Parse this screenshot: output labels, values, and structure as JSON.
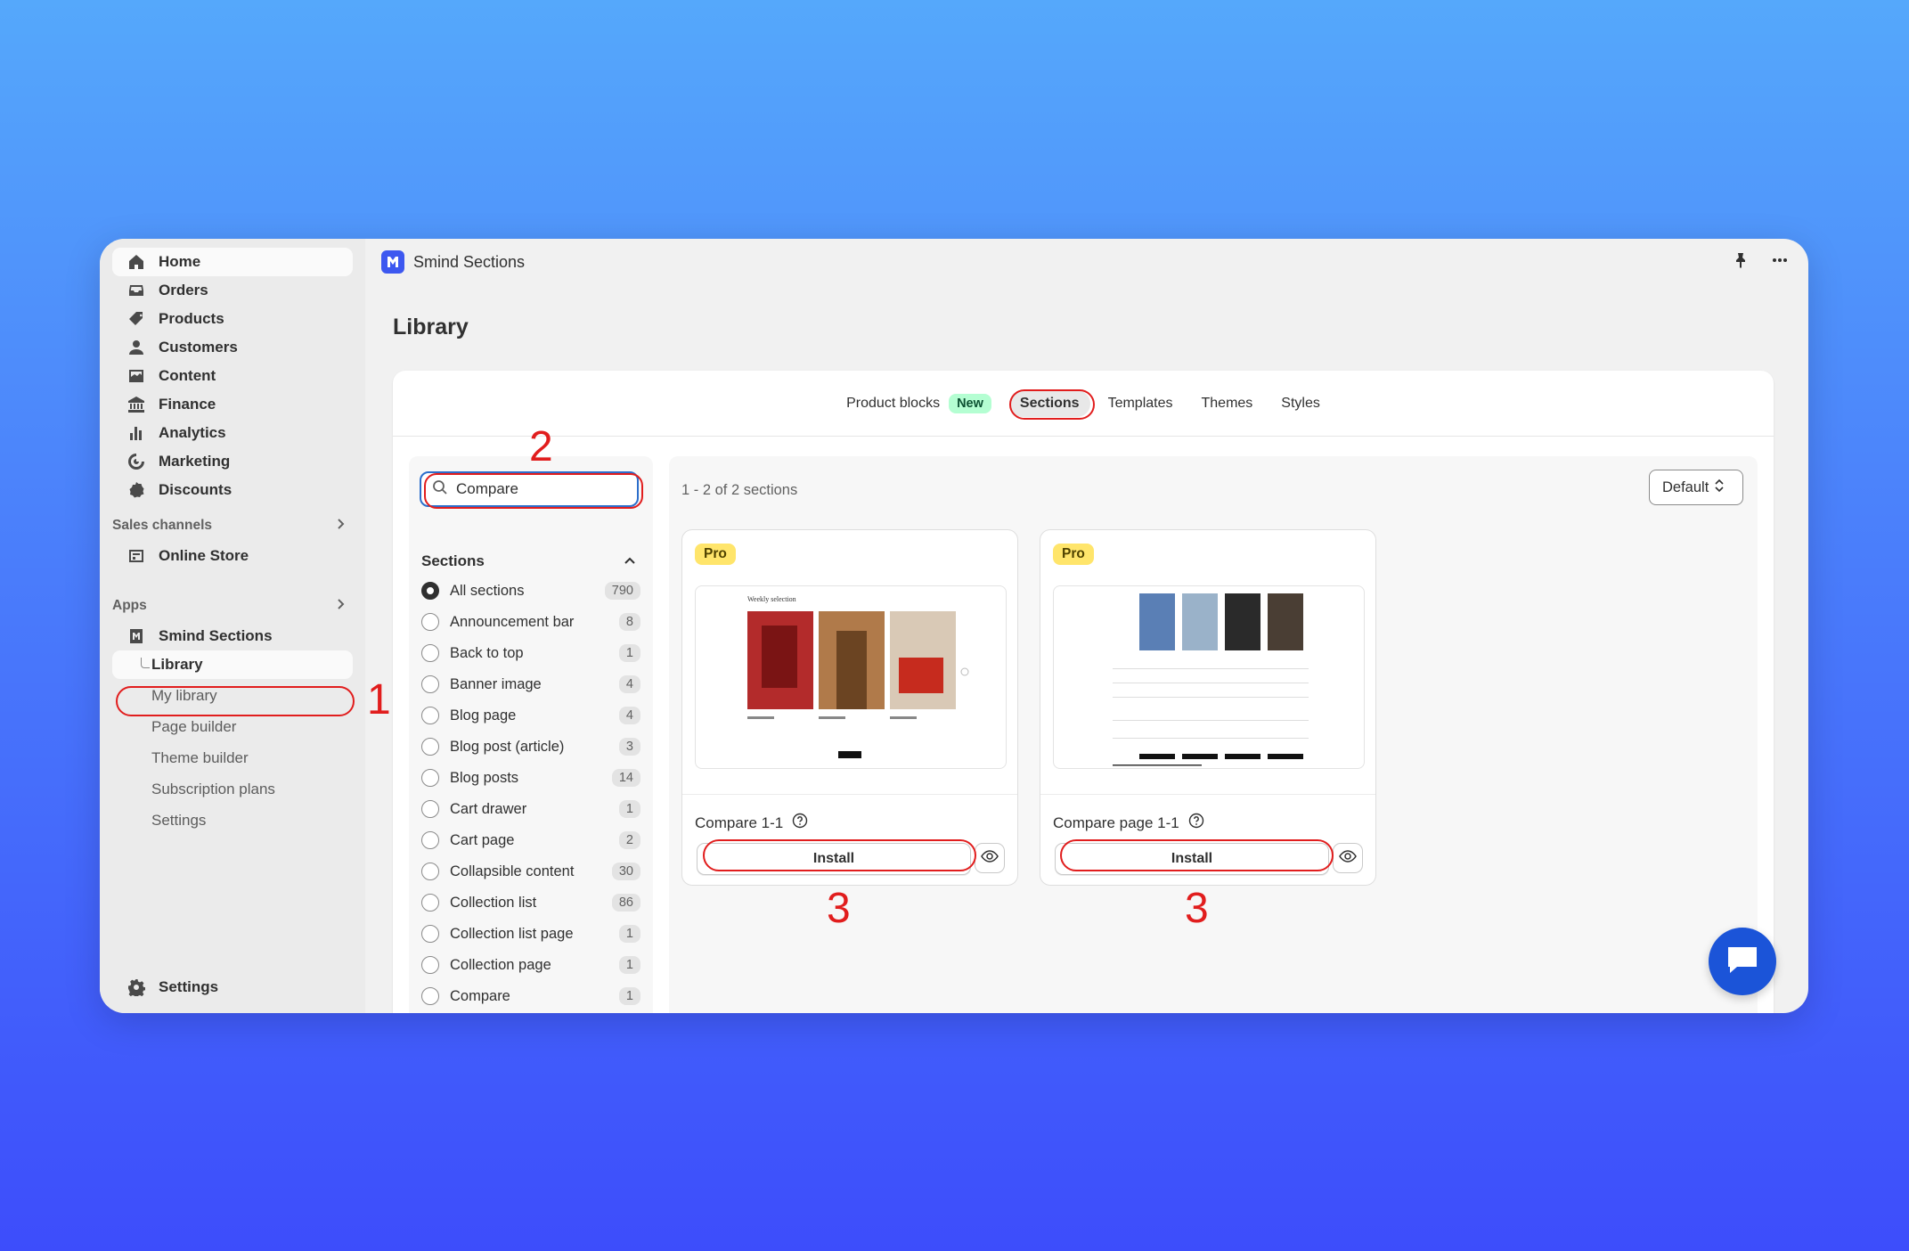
{
  "window": {
    "app_title": "Smind Sections",
    "page_title": "Library"
  },
  "sidebar": {
    "main_items": [
      {
        "label": "Home",
        "icon": "home-icon"
      },
      {
        "label": "Orders",
        "icon": "inbox-icon"
      },
      {
        "label": "Products",
        "icon": "tag-icon"
      },
      {
        "label": "Customers",
        "icon": "person-icon"
      },
      {
        "label": "Content",
        "icon": "content-icon"
      },
      {
        "label": "Finance",
        "icon": "bank-icon"
      },
      {
        "label": "Analytics",
        "icon": "bar-chart-icon"
      },
      {
        "label": "Marketing",
        "icon": "target-icon"
      },
      {
        "label": "Discounts",
        "icon": "discount-icon"
      }
    ],
    "sales_channels_heading": "Sales channels",
    "online_store": "Online Store",
    "apps_heading": "Apps",
    "app_name": "Smind Sections",
    "app_subitems": [
      "Library",
      "My library",
      "Page builder",
      "Theme builder",
      "Subscription plans",
      "Settings"
    ],
    "settings": "Settings"
  },
  "tabs": {
    "product_blocks": "Product blocks",
    "new_badge": "New",
    "sections": "Sections",
    "templates": "Templates",
    "themes": "Themes",
    "styles": "Styles"
  },
  "filters": {
    "search_value": "Compare",
    "sections_title": "Sections",
    "options": [
      {
        "label": "All sections",
        "count": "790",
        "selected": true
      },
      {
        "label": "Announcement bar",
        "count": "8"
      },
      {
        "label": "Back to top",
        "count": "1"
      },
      {
        "label": "Banner image",
        "count": "4"
      },
      {
        "label": "Blog page",
        "count": "4"
      },
      {
        "label": "Blog post (article)",
        "count": "3"
      },
      {
        "label": "Blog posts",
        "count": "14"
      },
      {
        "label": "Cart drawer",
        "count": "1"
      },
      {
        "label": "Cart page",
        "count": "2"
      },
      {
        "label": "Collapsible content",
        "count": "30"
      },
      {
        "label": "Collection list",
        "count": "86"
      },
      {
        "label": "Collection list page",
        "count": "1"
      },
      {
        "label": "Collection page",
        "count": "1"
      },
      {
        "label": "Compare",
        "count": "1"
      }
    ]
  },
  "results": {
    "count_text": "1 - 2 of 2 sections",
    "sort_label": "Default",
    "cards": [
      {
        "badge": "Pro",
        "name": "Compare 1-1",
        "install": "Install",
        "preview_title": "Weekly selection"
      },
      {
        "badge": "Pro",
        "name": "Compare page 1-1",
        "install": "Install"
      }
    ]
  },
  "annotations": [
    "1",
    "2",
    "3",
    "3"
  ],
  "colors": {
    "accent_red": "#e11d1d",
    "pro_yellow": "#ffe56b",
    "new_green": "#b4fed2",
    "chat_blue": "#1b54d8"
  }
}
